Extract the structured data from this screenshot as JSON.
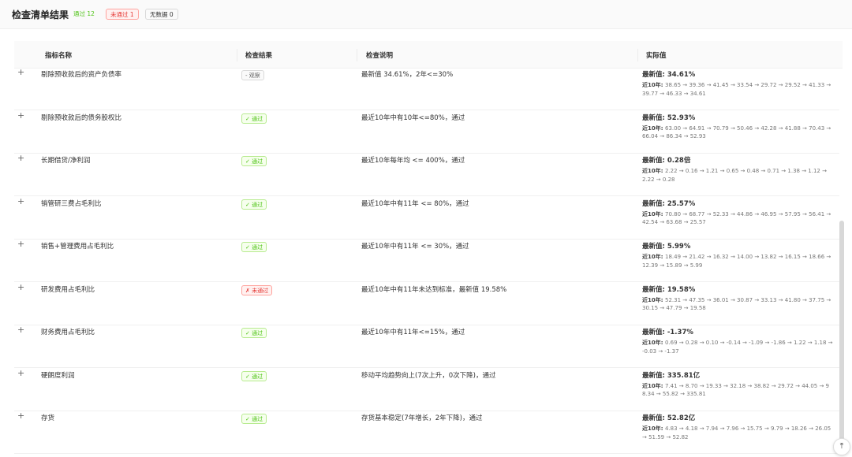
{
  "header": {
    "title": "检查清单结果",
    "badges": {
      "pass": "通过 12",
      "fail": "未通过 1",
      "none": "无数据 0"
    }
  },
  "table": {
    "columns": [
      "指标名称",
      "检查结果",
      "检查说明",
      "实际值"
    ],
    "expand_glyph": "+",
    "history_prefix": "近10年: ",
    "rows": [
      {
        "name": "剔除预收款后的资产负债率",
        "status": "watch",
        "tag": "- 观察",
        "desc": "最新值 34.61%，2年<=30%",
        "latest": "最新值: 34.61%",
        "history": "38.65 → 39.36 → 41.45 → 33.54 → 29.72 → 29.52 → 41.33 → 39.77 → 46.33 → 34.61"
      },
      {
        "name": "剔除预收款后的债务股权比",
        "status": "pass",
        "tag": "✓ 通过",
        "desc": "最近10年中有10年<=80%，通过",
        "latest": "最新值: 52.93%",
        "history": "63.00 → 64.91 → 70.79 → 50.46 → 42.28 → 41.88 → 70.43 → 66.04 → 86.34 → 52.93"
      },
      {
        "name": "长期借贷/净利润",
        "status": "pass",
        "tag": "✓ 通过",
        "desc": "最近10年每年均 <= 400%，通过",
        "latest": "最新值: 0.28倍",
        "history": "2.22 → 0.16 → 1.21 → 0.65 → 0.48 → 0.71 → 1.38 → 1.12 → 2.22 → 0.28"
      },
      {
        "name": "销管研三费占毛利比",
        "status": "pass",
        "tag": "✓ 通过",
        "desc": "最近10年中有11年 <= 80%，通过",
        "latest": "最新值: 25.57%",
        "history": "70.80 → 68.77 → 52.33 → 44.86 → 46.95 → 57.95 → 56.41 → 42.54 → 63.68 → 25.57"
      },
      {
        "name": "销售+管理费用占毛利比",
        "status": "pass",
        "tag": "✓ 通过",
        "desc": "最近10年中有11年 <= 30%，通过",
        "latest": "最新值: 5.99%",
        "history": "18.49 → 21.42 → 16.32 → 14.00 → 13.82 → 16.15 → 18.66 → 12.39 → 15.89 → 5.99"
      },
      {
        "name": "研发费用占毛利比",
        "status": "fail",
        "tag": "✗ 未通过",
        "desc": "最近10年中有11年未达到标准，最新值 19.58%",
        "latest": "最新值: 19.58%",
        "history": "52.31 → 47.35 → 36.01 → 30.87 → 33.13 → 41.80 → 37.75 → 30.15 → 47.79 → 19.58"
      },
      {
        "name": "财务费用占毛利比",
        "status": "pass",
        "tag": "✓ 通过",
        "desc": "最近10年中有11年<=15%，通过",
        "latest": "最新值: -1.37%",
        "history": "0.69 → 0.28 → 0.10 → -0.14 → -1.09 → -1.86 → 1.22 → 1.18 → -0.03 → -1.37"
      },
      {
        "name": "硬朗度利润",
        "status": "pass",
        "tag": "✓ 通过",
        "desc": "移动平均趋势向上(7次上升，0次下降)，通过",
        "latest": "最新值: 335.81亿",
        "history": "7.41 → 8.70 → 19.33 → 32.18 → 38.82 → 29.72 → 44.05 → 98.34 → 55.82 → 335.81"
      },
      {
        "name": "存货",
        "status": "pass",
        "tag": "✓ 通过",
        "desc": "存货基本稳定(7年增长，2年下降)，通过",
        "latest": "最新值: 52.82亿",
        "history": "4.83 → 4.18 → 7.94 → 7.96 → 15.75 → 9.79 → 18.26 → 26.05 → 51.59 → 52.82"
      }
    ]
  },
  "back_to_top_glyph": "⤒"
}
